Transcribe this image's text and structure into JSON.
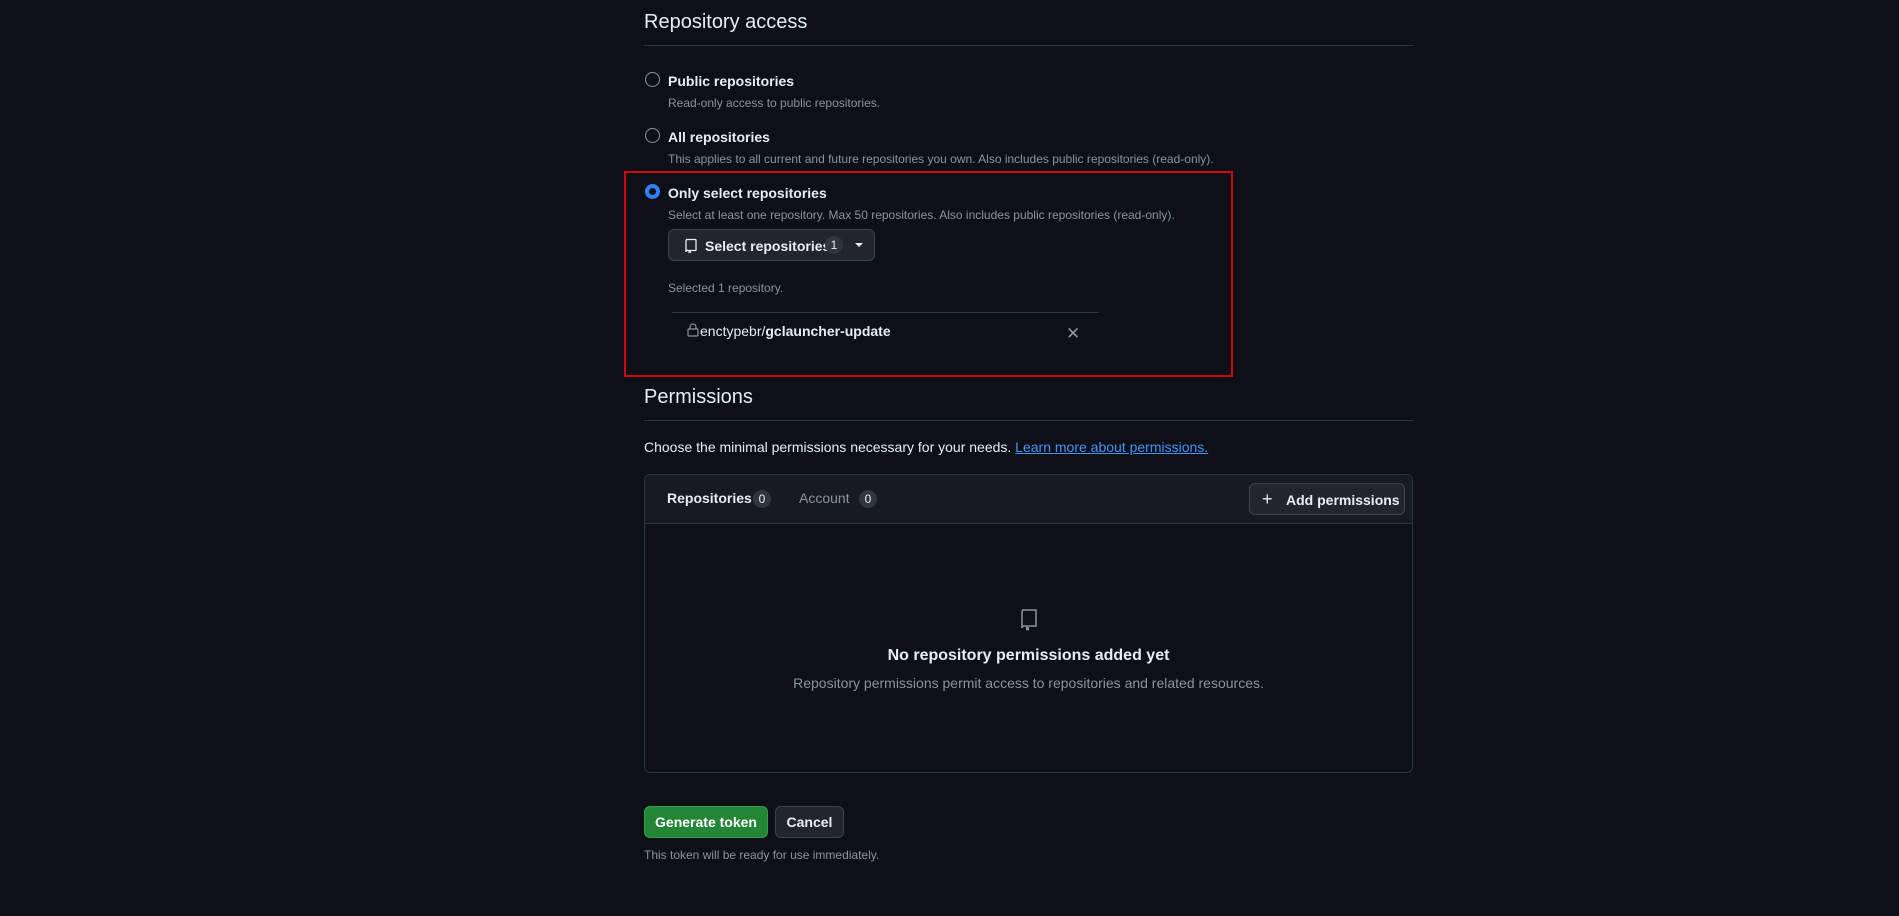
{
  "repo_access": {
    "title": "Repository access",
    "options": [
      {
        "label": "Public repositories",
        "description": "Read-only access to public repositories.",
        "selected": false
      },
      {
        "label": "All repositories",
        "description": "This applies to all current and future repositories you own. Also includes public repositories (read-only).",
        "selected": false
      },
      {
        "label": "Only select repositories",
        "description": "Select at least one repository. Max 50 repositories. Also includes public repositories (read-only).",
        "selected": true
      }
    ],
    "select_button": {
      "label": "Select repositories",
      "count": "1",
      "icon": "repo-icon"
    },
    "selected_text": "Selected 1 repository.",
    "selected_repo": {
      "owner": "enctypebr/",
      "name": "gclauncher-update",
      "icon": "lock-icon"
    }
  },
  "permissions": {
    "title": "Permissions",
    "intro": "Choose the minimal permissions necessary for your needs.",
    "learn_more": "Learn more about permissions.",
    "tabs": [
      {
        "label": "Repositories",
        "count": "0",
        "active": true
      },
      {
        "label": "Account",
        "count": "0",
        "active": false
      }
    ],
    "add_button": "Add permissions",
    "empty_title": "No repository permissions added yet",
    "empty_desc": "Repository permissions permit access to repositories and related resources."
  },
  "actions": {
    "generate": "Generate token",
    "cancel": "Cancel",
    "note": "This token will be ready for use immediately."
  },
  "colors": {
    "background": "#0d1117",
    "accent": "#2f81f7",
    "primary_button": "#238636",
    "highlight_border": "#d0070b"
  }
}
